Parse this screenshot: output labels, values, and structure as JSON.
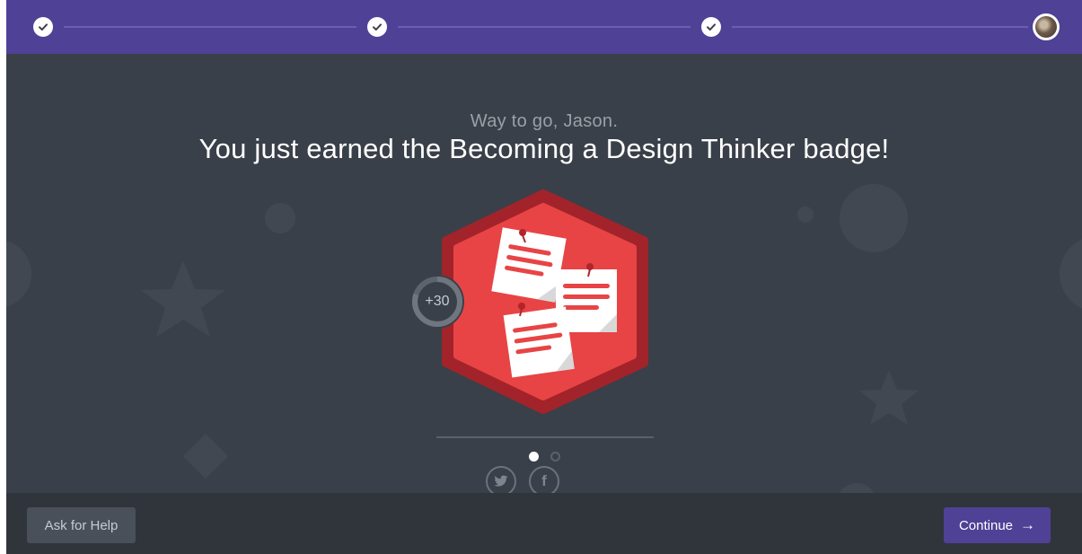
{
  "progress": {
    "steps": [
      {
        "state": "complete",
        "icon": "check-icon"
      },
      {
        "state": "complete",
        "icon": "check-icon"
      },
      {
        "state": "complete",
        "icon": "check-icon"
      },
      {
        "state": "current",
        "icon": "user-avatar"
      }
    ]
  },
  "header": {
    "greeting": "Way to go, Jason.",
    "headline": "You just earned the Becoming a Design Thinker badge!"
  },
  "badge": {
    "name": "Becoming a Design Thinker",
    "icon": "sticky-notes-badge-icon",
    "points": "+30",
    "points_progress": 0.8
  },
  "carousel": {
    "active_index": 0,
    "count": 2
  },
  "share": {
    "twitter_icon": "twitter-icon",
    "facebook_icon": "facebook-icon",
    "twitter_glyph": "🐦",
    "facebook_glyph": "f"
  },
  "footer": {
    "help_label": "Ask for Help",
    "continue_label": "Continue",
    "continue_arrow": "→"
  },
  "colors": {
    "brand": "#4f4196",
    "background": "#3a4049",
    "footer": "#30353c",
    "badge_red": "#e84445",
    "badge_dark_red": "#a3232a"
  }
}
